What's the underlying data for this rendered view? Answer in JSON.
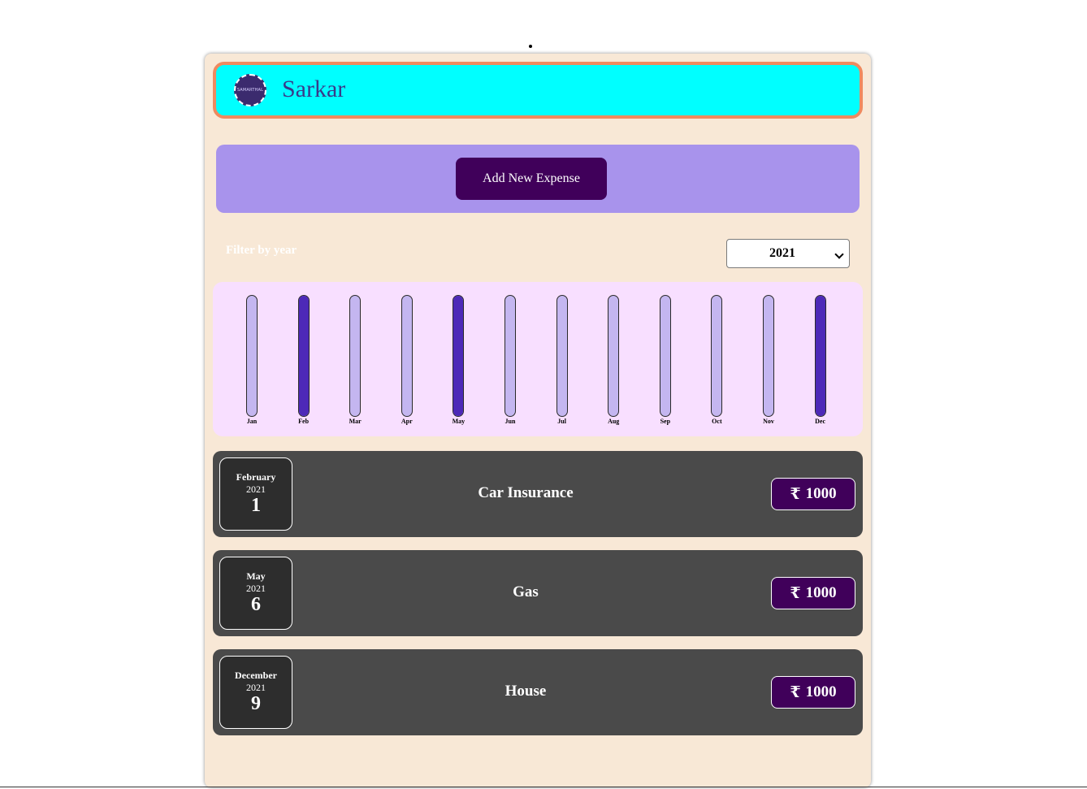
{
  "header": {
    "logo_text": "SAMARTHAL",
    "app_name": "Sarkar"
  },
  "add_panel": {
    "button_label": "Add New Expense"
  },
  "filter": {
    "label": "Filter by year",
    "selected_year": "2021"
  },
  "chart_data": {
    "type": "bar",
    "categories": [
      "Jan",
      "Feb",
      "Mar",
      "Apr",
      "May",
      "Jun",
      "Jul",
      "Aug",
      "Sep",
      "Oct",
      "Nov",
      "Dec"
    ],
    "values": [
      0,
      1000,
      0,
      0,
      1000,
      0,
      0,
      0,
      0,
      0,
      0,
      1000
    ],
    "ylim": [
      0,
      1000
    ],
    "colors": {
      "fill": "#4d29b8",
      "track": "#c4b6f0"
    }
  },
  "expenses": [
    {
      "month": "February",
      "year": "2021",
      "day": "1",
      "title": "Car Insurance",
      "currency": "₹",
      "amount": "1000"
    },
    {
      "month": "May",
      "year": "2021",
      "day": "6",
      "title": "Gas",
      "currency": "₹",
      "amount": "1000"
    },
    {
      "month": "December",
      "year": "2021",
      "day": "9",
      "title": "House",
      "currency": "₹",
      "amount": "1000"
    }
  ],
  "colors": {
    "header_bg": "#00ffff",
    "header_border": "#ef8a5f",
    "accent": "#40005a",
    "panel": "#a893ec",
    "card": "#4a4a4a"
  }
}
